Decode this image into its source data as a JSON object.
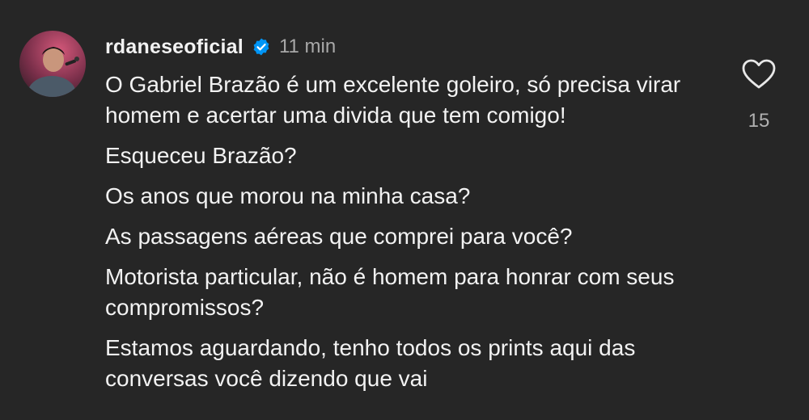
{
  "comment": {
    "username": "rdaneseoficial",
    "verified": true,
    "timestamp": "11 min",
    "paragraphs": [
      "O Gabriel Brazão é um excelente goleiro, só precisa virar homem e acertar uma divida que tem comigo!",
      "Esqueceu Brazão?",
      "Os anos que morou na minha casa?",
      "As passagens aéreas que comprei para você?",
      "Motorista particular, não é homem para honrar com seus compromissos?",
      "Estamos aguardando, tenho todos os prints aqui das conversas você dizendo que vai"
    ],
    "like_count": "15"
  },
  "colors": {
    "background": "#262626",
    "text": "#f2f2f2",
    "muted": "#a8a8a8",
    "verified_badge": "#0095f6"
  },
  "icons": {
    "verified": "verified-badge-icon",
    "like": "heart-outline-icon"
  }
}
